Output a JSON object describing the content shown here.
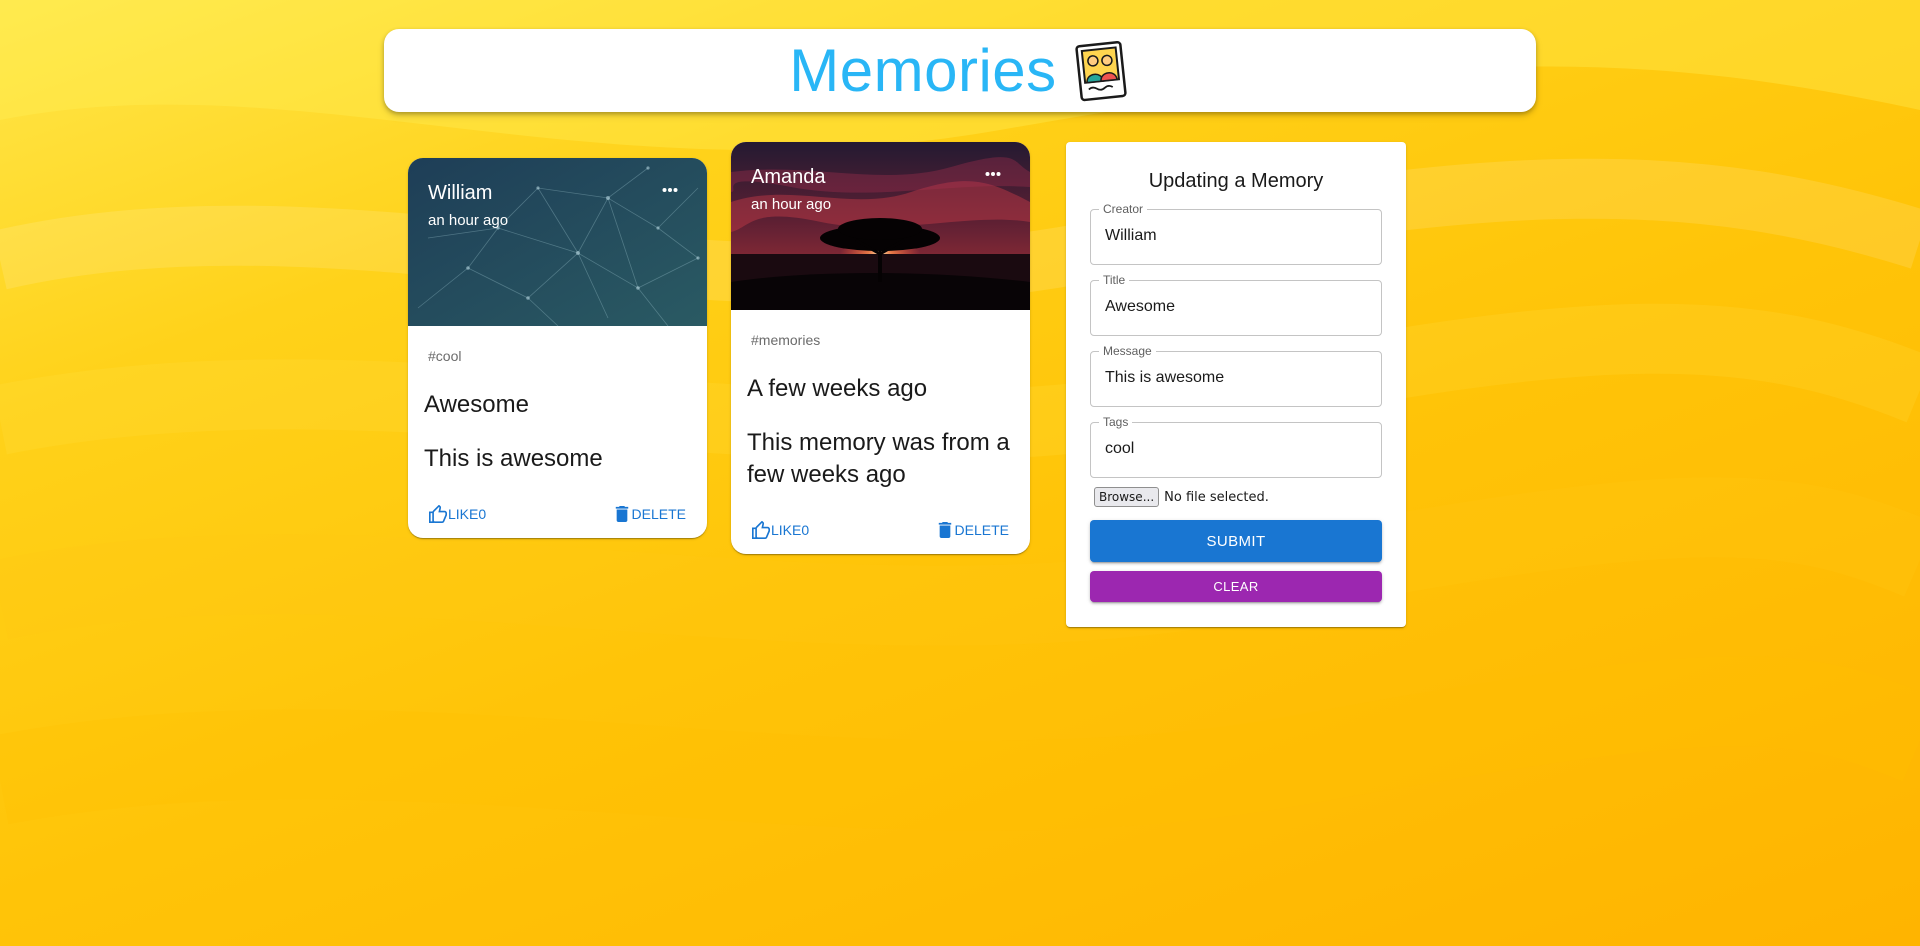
{
  "app": {
    "title": "Memories",
    "logo_icon": "memories-photo-icon"
  },
  "posts": [
    {
      "creator": "William",
      "time": "an hour ago",
      "tags": "#cool",
      "title": "Awesome",
      "message": "This is awesome",
      "like_label": "LIKE",
      "like_count": "0",
      "delete_label": "DELETE",
      "image": "abstract-network-teal"
    },
    {
      "creator": "Amanda",
      "time": "an hour ago",
      "tags": "#memories",
      "title": "A few weeks ago",
      "message": "This memory was from a few weeks ago",
      "like_label": "LIKE",
      "like_count": "0",
      "delete_label": "DELETE",
      "image": "tree-sunset-silhouette"
    }
  ],
  "form": {
    "heading": "Updating a Memory",
    "fields": {
      "creator": {
        "label": "Creator",
        "value": "William"
      },
      "title": {
        "label": "Title",
        "value": "Awesome"
      },
      "message": {
        "label": "Message",
        "value": "This is awesome"
      },
      "tags": {
        "label": "Tags",
        "value": "cool"
      }
    },
    "file": {
      "button_label": "Browse...",
      "status": "No file selected."
    },
    "submit_label": "SUBMIT",
    "clear_label": "CLEAR"
  },
  "colors": {
    "title": "#29b6f6",
    "primary": "#1976d2",
    "secondary": "#9c27b0",
    "background": "#ffc107"
  }
}
